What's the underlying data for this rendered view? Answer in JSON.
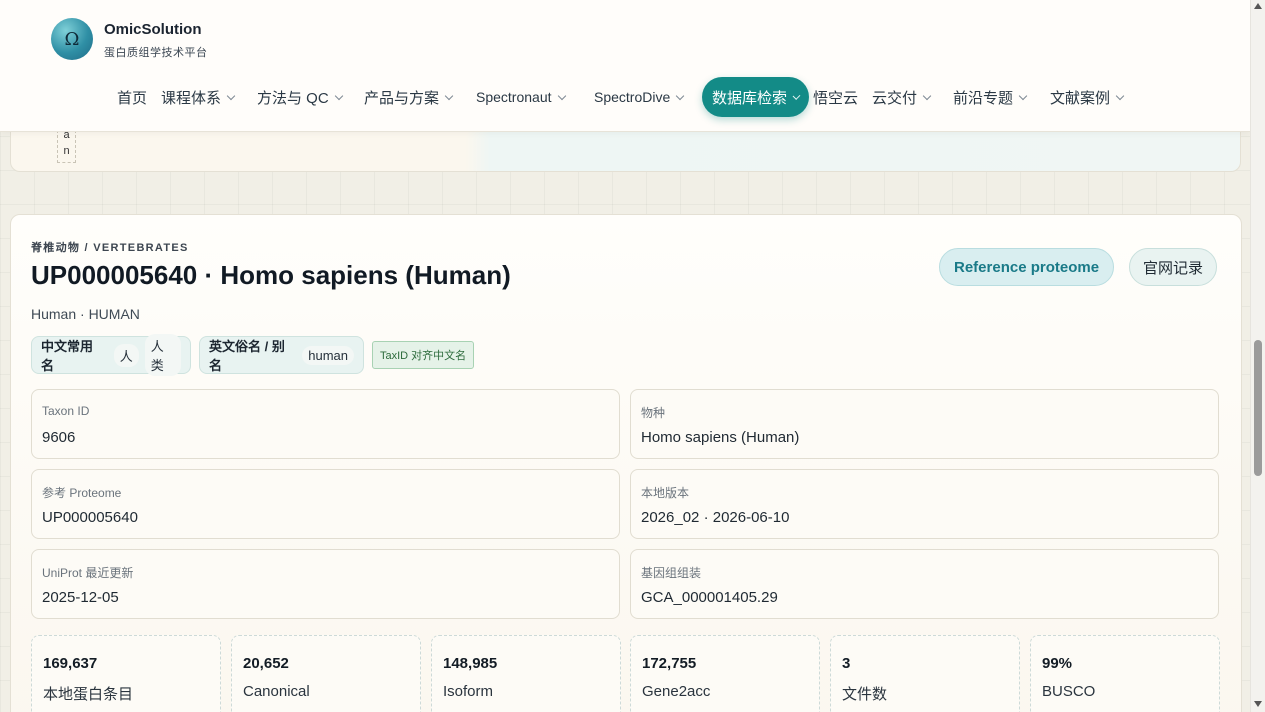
{
  "brand": {
    "name": "OmicSolution",
    "subtitle": "蛋白质组学技术平台",
    "logo_glyph": "Ω"
  },
  "nav": [
    {
      "label": "首页",
      "has_dropdown": false
    },
    {
      "label": "课程体系",
      "has_dropdown": true
    },
    {
      "label": "方法与 QC",
      "has_dropdown": true
    },
    {
      "label": "产品与方案",
      "has_dropdown": true
    },
    {
      "label": "Spectronaut",
      "has_dropdown": true
    },
    {
      "label": "SpectroDive",
      "has_dropdown": true
    },
    {
      "label": "数据库检索",
      "has_dropdown": true,
      "active": true
    },
    {
      "label": "悟空云",
      "has_dropdown": false
    },
    {
      "label": "云交付",
      "has_dropdown": true
    },
    {
      "label": "前沿专题",
      "has_dropdown": true
    },
    {
      "label": "文献案例",
      "has_dropdown": true
    }
  ],
  "prev_card": {
    "tag_chars": [
      "a",
      "n"
    ]
  },
  "proteome": {
    "kicker": "脊椎动物 / VERTEBRATES",
    "title": "UP000005640 · Homo sapiens (Human)",
    "subtitle": "Human · HUMAN",
    "reference_button": "Reference proteome",
    "official_button": "官网记录",
    "chips": {
      "cn_label": "中文常用名",
      "cn_values": [
        "人",
        "人类"
      ],
      "en_label": "英文俗名 / 别名",
      "en_value": "human",
      "taxid_badge": "TaxID 对齐中文名"
    },
    "fields": [
      {
        "label": "Taxon ID",
        "value": "9606"
      },
      {
        "label": "物种",
        "value": "Homo sapiens (Human)"
      },
      {
        "label": "参考 Proteome",
        "value": "UP000005640"
      },
      {
        "label": "本地版本",
        "value": "2026_02 · 2026-06-10"
      },
      {
        "label": "UniProt 最近更新",
        "value": "2025-12-05"
      },
      {
        "label": "基因组组装",
        "value": "GCA_000001405.29"
      }
    ],
    "stats": [
      {
        "value": "169,637",
        "label": "本地蛋白条目"
      },
      {
        "value": "20,652",
        "label": "Canonical"
      },
      {
        "value": "148,985",
        "label": "Isoform"
      },
      {
        "value": "172,755",
        "label": "Gene2acc"
      },
      {
        "value": "3",
        "label": "文件数"
      },
      {
        "value": "99%",
        "label": "BUSCO"
      }
    ]
  },
  "colors": {
    "accent": "#138b87",
    "reference_text": "#1a7a88"
  }
}
